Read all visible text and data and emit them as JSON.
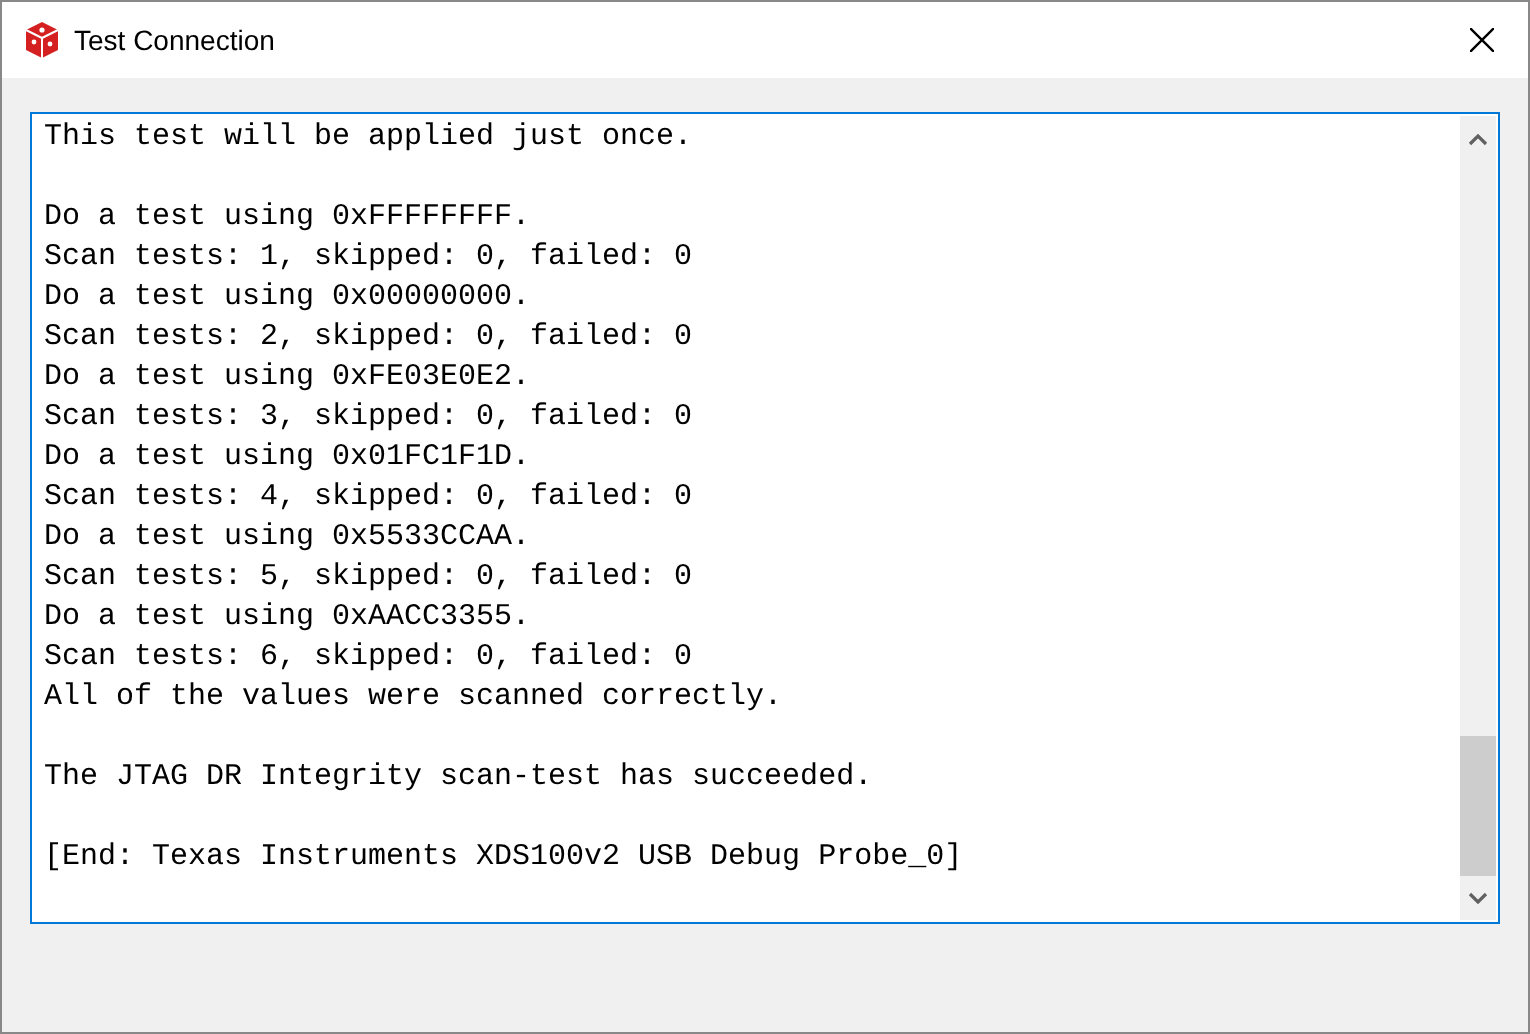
{
  "window": {
    "title": "Test Connection"
  },
  "log": {
    "paragraphs": [
      [
        "This test will be applied just once."
      ],
      [
        "Do a test using 0xFFFFFFFF.",
        "Scan tests: 1, skipped: 0, failed: 0",
        "Do a test using 0x00000000.",
        "Scan tests: 2, skipped: 0, failed: 0",
        "Do a test using 0xFE03E0E2.",
        "Scan tests: 3, skipped: 0, failed: 0",
        "Do a test using 0x01FC1F1D.",
        "Scan tests: 4, skipped: 0, failed: 0",
        "Do a test using 0x5533CCAA.",
        "Scan tests: 5, skipped: 0, failed: 0",
        "Do a test using 0xAACC3355.",
        "Scan tests: 6, skipped: 0, failed: 0",
        "All of the values were scanned correctly."
      ],
      [
        "The JTAG DR Integrity scan-test has succeeded."
      ],
      [
        "[End: Texas Instruments XDS100v2 USB Debug Probe_0]"
      ]
    ]
  }
}
